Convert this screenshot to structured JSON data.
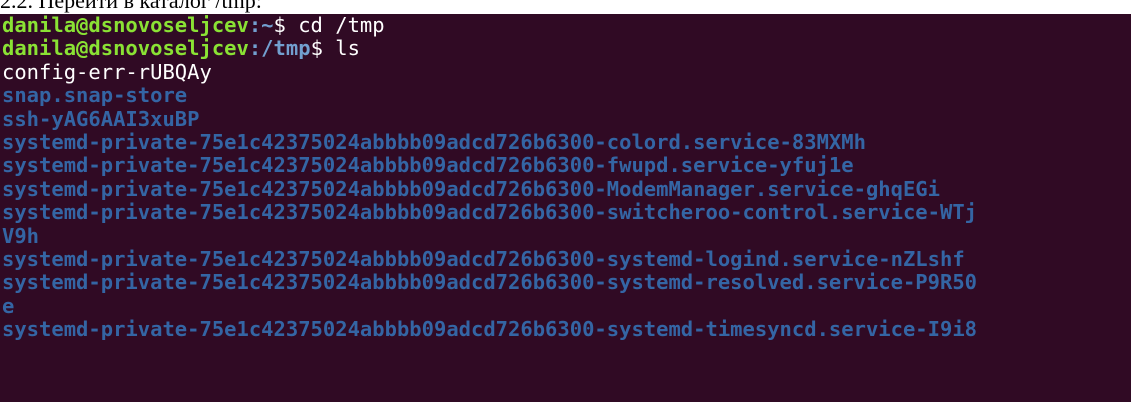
{
  "caption": "2.2. Перейти в каталог /tmp:",
  "colors": {
    "background": "#300a24",
    "prompt_user": "#8ae234",
    "prompt_path": "#729fcf",
    "directory": "#3465a4",
    "text": "#ffffff"
  },
  "terminal": {
    "prompt1": {
      "user_host": "danila@dsnovoseljcev",
      "path": ":~",
      "symbol": "$ ",
      "command": "cd /tmp"
    },
    "prompt2": {
      "user_host": "danila@dsnovoseljcev",
      "path": ":/tmp",
      "symbol": "$ ",
      "command": "ls"
    },
    "output": [
      {
        "text": "config-err-rUBQAy",
        "type": "file"
      },
      {
        "text": "snap.snap-store",
        "type": "dir"
      },
      {
        "text": "ssh-yAG6AAI3xuBP",
        "type": "dir"
      },
      {
        "text": "systemd-private-75e1c42375024abbbb09adcd726b6300-colord.service-83MXMh",
        "type": "dir"
      },
      {
        "text": "systemd-private-75e1c42375024abbbb09adcd726b6300-fwupd.service-yfuj1e",
        "type": "dir"
      },
      {
        "text": "systemd-private-75e1c42375024abbbb09adcd726b6300-ModemManager.service-ghqEGi",
        "type": "dir"
      },
      {
        "text": "systemd-private-75e1c42375024abbbb09adcd726b6300-switcheroo-control.service-WTj",
        "type": "dir"
      },
      {
        "text": "V9h",
        "type": "dir"
      },
      {
        "text": "systemd-private-75e1c42375024abbbb09adcd726b6300-systemd-logind.service-nZLshf",
        "type": "dir"
      },
      {
        "text": "systemd-private-75e1c42375024abbbb09adcd726b6300-systemd-resolved.service-P9R50",
        "type": "dir"
      },
      {
        "text": "e",
        "type": "dir"
      },
      {
        "text": "systemd-private-75e1c42375024abbbb09adcd726b6300-systemd-timesyncd.service-I9i8",
        "type": "dir"
      }
    ]
  }
}
